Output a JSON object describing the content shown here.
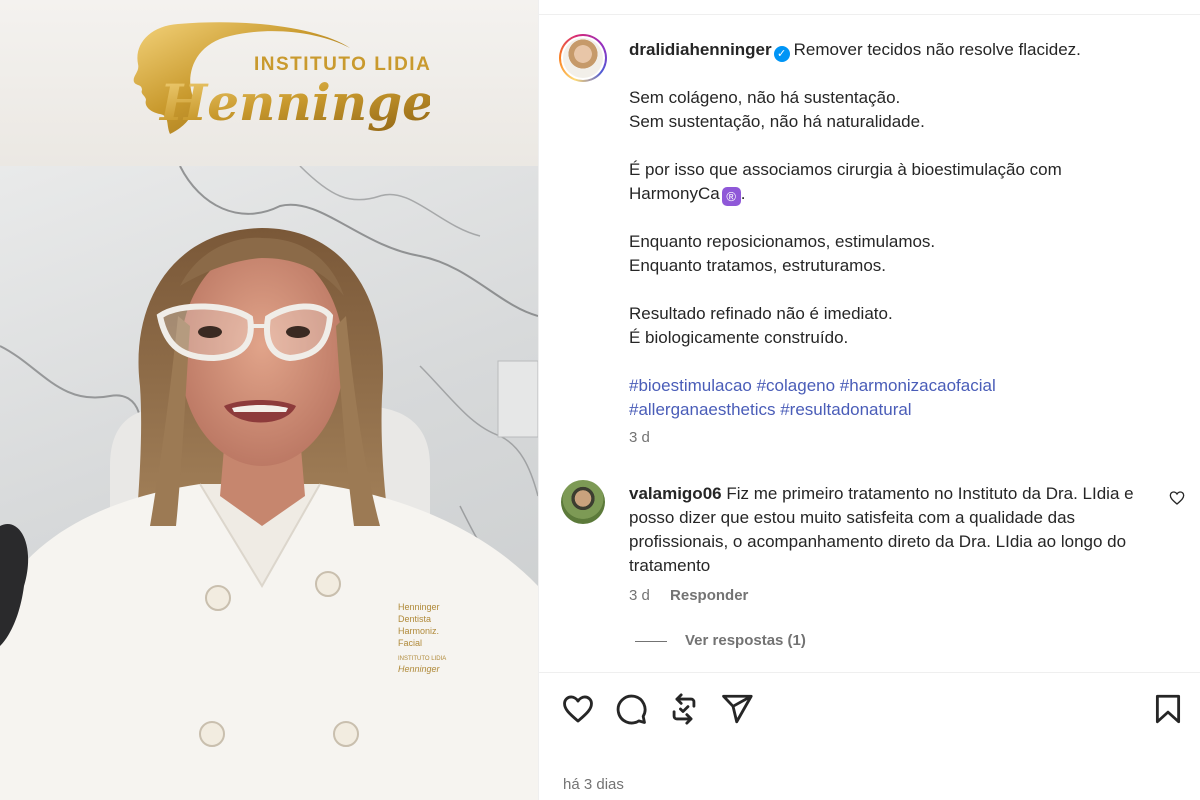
{
  "media": {
    "logo_line1": "INSTITUTO LIDIA",
    "logo_line2": "Henninger",
    "coat_embroidery": [
      "Henninger",
      "Dentista",
      "Harmoniz.",
      "Facial",
      "INSTITUTO LIDIA",
      "Henninger"
    ]
  },
  "post": {
    "username": "dralidiahenninger",
    "verified_glyph": "✓",
    "caption": {
      "line1": "Remover tecidos não resolve flacidez.",
      "line2": "Sem colágeno, não há sustentação.",
      "line3": "Sem sustentação, não há naturalidade.",
      "line4": "É por isso que associamos cirurgia à bioestimulação com",
      "line5": "HarmonyCa",
      "line5_symbol": "®",
      "line5_end": ".",
      "line6": "Enquanto reposicionamos, estimulamos.",
      "line7": "Enquanto tratamos, estruturamos.",
      "line8": "Resultado refinado não é imediato.",
      "line9": "É biologicamente construído."
    },
    "hashtags": [
      "#bioestimulacao",
      "#colageno",
      "#harmonizacaofacial",
      "#allerganaesthetics",
      "#resultadonatural"
    ],
    "time": "3 d"
  },
  "comment": {
    "username": "valamigo06",
    "text": "Fiz me primeiro tratamento no Instituto da Dra. LIdia e posso dizer que estou muito satisfeita com a qualidade das profissionais, o acompanhamento direto da Dra. LIdia ao longo do tratamento",
    "time": "3 d",
    "reply_label": "Responder",
    "view_replies": "Ver respostas (1)"
  },
  "actions": {
    "icons": [
      "heart-icon",
      "comment-icon",
      "repost-icon",
      "share-icon",
      "bookmark-icon"
    ]
  },
  "footer": {
    "date": "há 3 dias"
  },
  "colors": {
    "link": "#4a5db8",
    "muted": "#737373",
    "verified": "#0095f6",
    "gold": "#c99a2e",
    "registered_badge": "#8f58d8"
  }
}
